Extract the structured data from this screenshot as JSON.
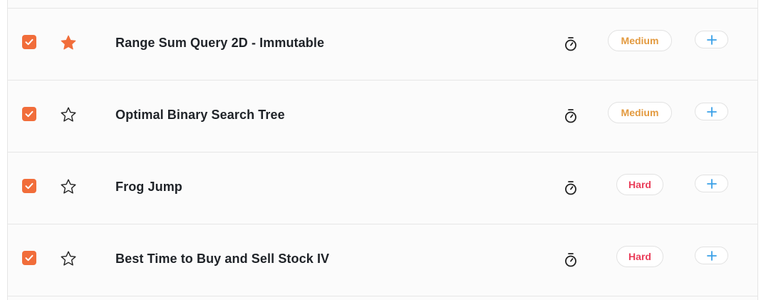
{
  "problems": [
    {
      "title": "Range Sum Query 2D - Immutable",
      "difficulty": "Medium",
      "completed": true,
      "starred": true
    },
    {
      "title": "Optimal Binary Search Tree",
      "difficulty": "Medium",
      "completed": true,
      "starred": false
    },
    {
      "title": "Frog Jump",
      "difficulty": "Hard",
      "completed": true,
      "starred": false
    },
    {
      "title": "Best Time to Buy and Sell Stock IV",
      "difficulty": "Hard",
      "completed": true,
      "starred": false
    }
  ],
  "icons": {
    "checkbox": "check-icon",
    "star_filled": "star-filled-icon",
    "star_outline": "star-outline-icon",
    "timer": "stopwatch-icon",
    "add": "plus-icon"
  },
  "colors": {
    "accent": "#f16d3a",
    "medium": "#e39a3f",
    "hard": "#ea3e5a",
    "add": "#3aa0e8"
  }
}
